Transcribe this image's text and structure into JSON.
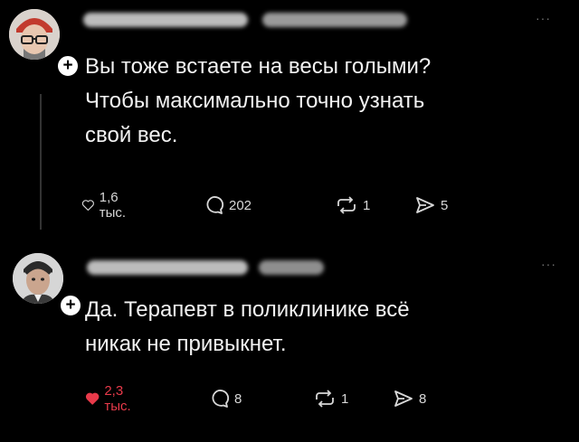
{
  "post1": {
    "text": "Вы тоже встаете на весы голыми?\nЧтобы максимально точно узнать\nсвой вес.",
    "menu": "···",
    "actions": {
      "likes": "1,6 тыс.",
      "replies": "202",
      "reposts": "1",
      "shares": "5"
    }
  },
  "post2": {
    "text": "Да. Терапевт в поликлинике всё\nникак не привыкнет.",
    "menu": "···",
    "actions": {
      "likes": "2,3 тыс.",
      "replies": "8",
      "reposts": "1",
      "shares": "8"
    }
  },
  "colors": {
    "background": "#000000",
    "text": "#f2f2f2",
    "liked": "#e83a4a",
    "icon": "#d8d8d8"
  },
  "icons": [
    "heart-icon",
    "comment-icon",
    "repost-icon",
    "share-icon",
    "follow-plus-icon"
  ]
}
